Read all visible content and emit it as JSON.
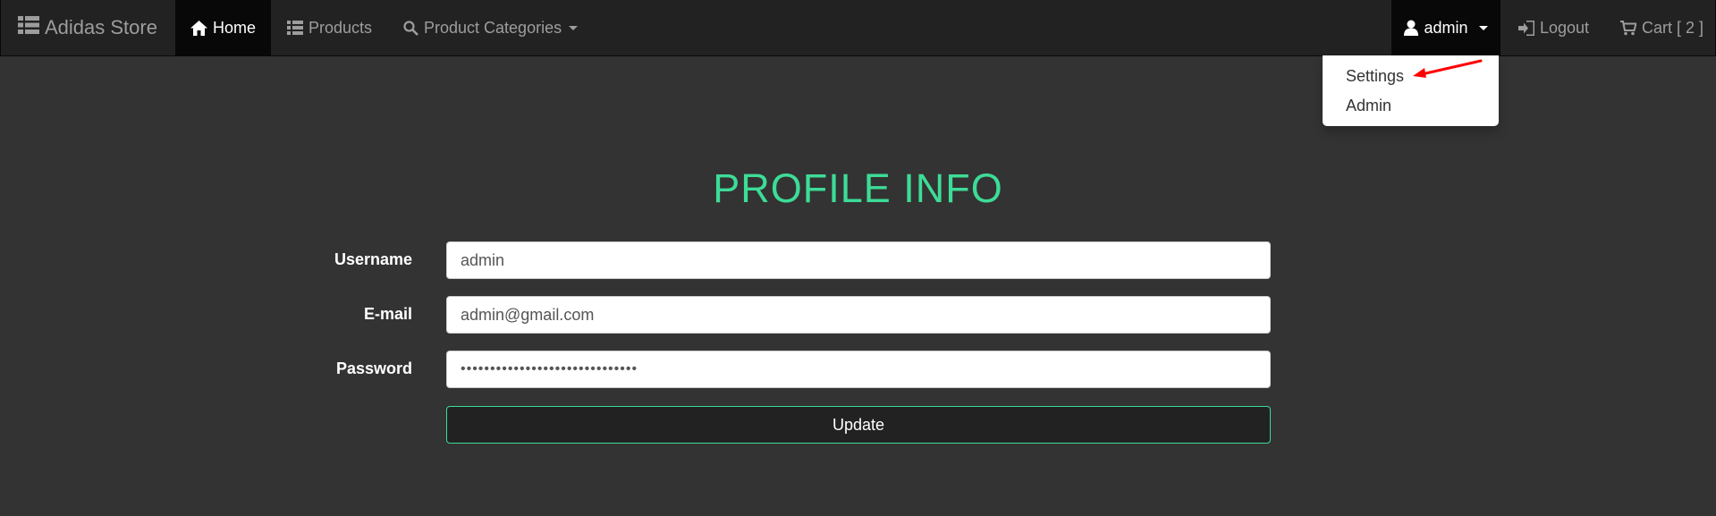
{
  "nav": {
    "brand": "Adidas Store",
    "home": "Home",
    "products": "Products",
    "categories": "Product Categories",
    "user": "admin",
    "logout": "Logout",
    "cart": "Cart [ 2 ]"
  },
  "dropdown": {
    "items": [
      "Settings",
      "Admin"
    ]
  },
  "annotation": {
    "color": "#ff0000"
  },
  "profile": {
    "title": "PROFILE INFO",
    "username_label": "Username",
    "username_value": "admin",
    "email_label": "E-mail",
    "email_value": "admin@gmail.com",
    "password_label": "Password",
    "password_value": "••••••••••••••••••••••••••••••",
    "update_label": "Update"
  },
  "colors": {
    "accent": "#3ddc97",
    "navbar": "#222222",
    "background": "#333333"
  },
  "icons": {
    "brand": "list-icon",
    "home": "home-icon",
    "products": "list-icon",
    "categories": "search-icon",
    "user": "user-icon",
    "logout": "log-in-icon",
    "cart": "shopping-cart-icon"
  }
}
